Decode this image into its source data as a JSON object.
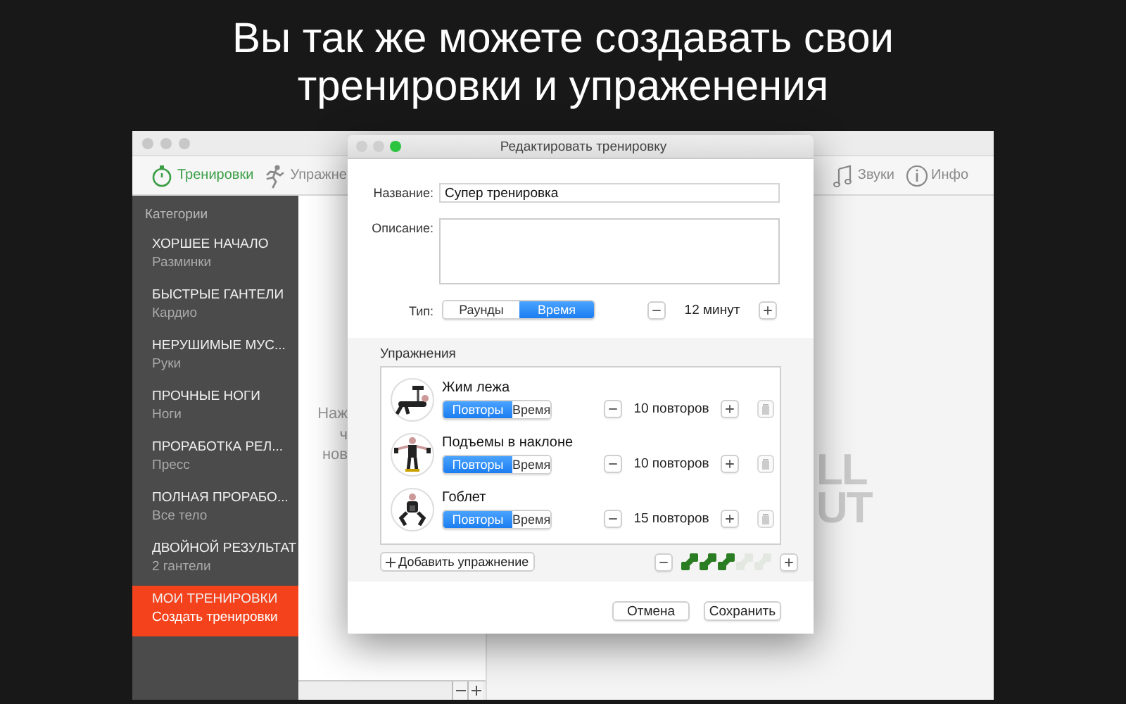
{
  "caption": {
    "lines": [
      "Вы так же можете создавать свои",
      "тренировки и упраженения"
    ]
  },
  "main_window": {
    "toolbar_left": [
      {
        "kind": "stopwatch",
        "label": "Тренировки",
        "selected": true
      },
      {
        "kind": "runner",
        "label": "Упражне",
        "selected": false
      }
    ],
    "toolbar_right": [
      {
        "kind": "note",
        "label": "Звуки",
        "selected": false
      },
      {
        "kind": "info",
        "label": "Инфо",
        "selected": false
      }
    ],
    "sidebar": {
      "heading": "Категории",
      "items": [
        {
          "title": "ХОРШЕЕ НАЧАЛО",
          "subtitle": "Разминки",
          "selected": false
        },
        {
          "title": "БЫСТРЫЕ ГАНТЕЛИ",
          "subtitle": "Кардио",
          "selected": false
        },
        {
          "title": "НЕРУШИМЫЕ МУС...",
          "subtitle": "Руки",
          "selected": false
        },
        {
          "title": "ПРОЧНЫЕ НОГИ",
          "subtitle": "Ноги",
          "selected": false
        },
        {
          "title": "ПРОРАБОТКА РЕЛ...",
          "subtitle": "Пресс",
          "selected": false
        },
        {
          "title": "ПОЛНАЯ ПРОРАБО...",
          "subtitle": "Все тело",
          "selected": false
        },
        {
          "title": "ДВОЙНОЙ РЕЗУЛЬТАТ",
          "subtitle": "2 гантели",
          "selected": false
        },
        {
          "title": "МОИ ТРЕНИРОВКИ",
          "subtitle": "Создать тренировки",
          "selected": true
        }
      ]
    },
    "middle_pane": {
      "hint_lines": [
        "Наж",
        "ч",
        "нов"
      ]
    },
    "right_pane": {
      "logo_lines": [
        "LL",
        "UT"
      ]
    }
  },
  "dialog": {
    "title": "Редактировать тренировку",
    "name_label": "Название:",
    "name_value": "Супер тренировка",
    "description_label": "Описание:",
    "type_label": "Тип:",
    "type_options": [
      {
        "label": "Раунды",
        "selected": false
      },
      {
        "label": "Время",
        "selected": true
      }
    ],
    "duration": "12 минут",
    "exercises": {
      "heading": "Упражнения",
      "items": [
        {
          "name": "Жим лежа",
          "mode_options": [
            {
              "label": "Повторы",
              "selected": true
            },
            {
              "label": "Время",
              "selected": false
            }
          ],
          "count": "10 повторов"
        },
        {
          "name": "Подъемы в наклоне",
          "mode_options": [
            {
              "label": "Повторы",
              "selected": true
            },
            {
              "label": "Время",
              "selected": false
            }
          ],
          "count": "10 повторов"
        },
        {
          "name": "Гоблет",
          "mode_options": [
            {
              "label": "Повторы",
              "selected": true
            },
            {
              "label": "Время",
              "selected": false
            }
          ],
          "count": "15 повторов"
        }
      ],
      "add_label": "Добавить упражнение",
      "difficulty": {
        "stars": 3
      }
    },
    "buttons": [
      "Отмена",
      "Сохранить"
    ]
  }
}
